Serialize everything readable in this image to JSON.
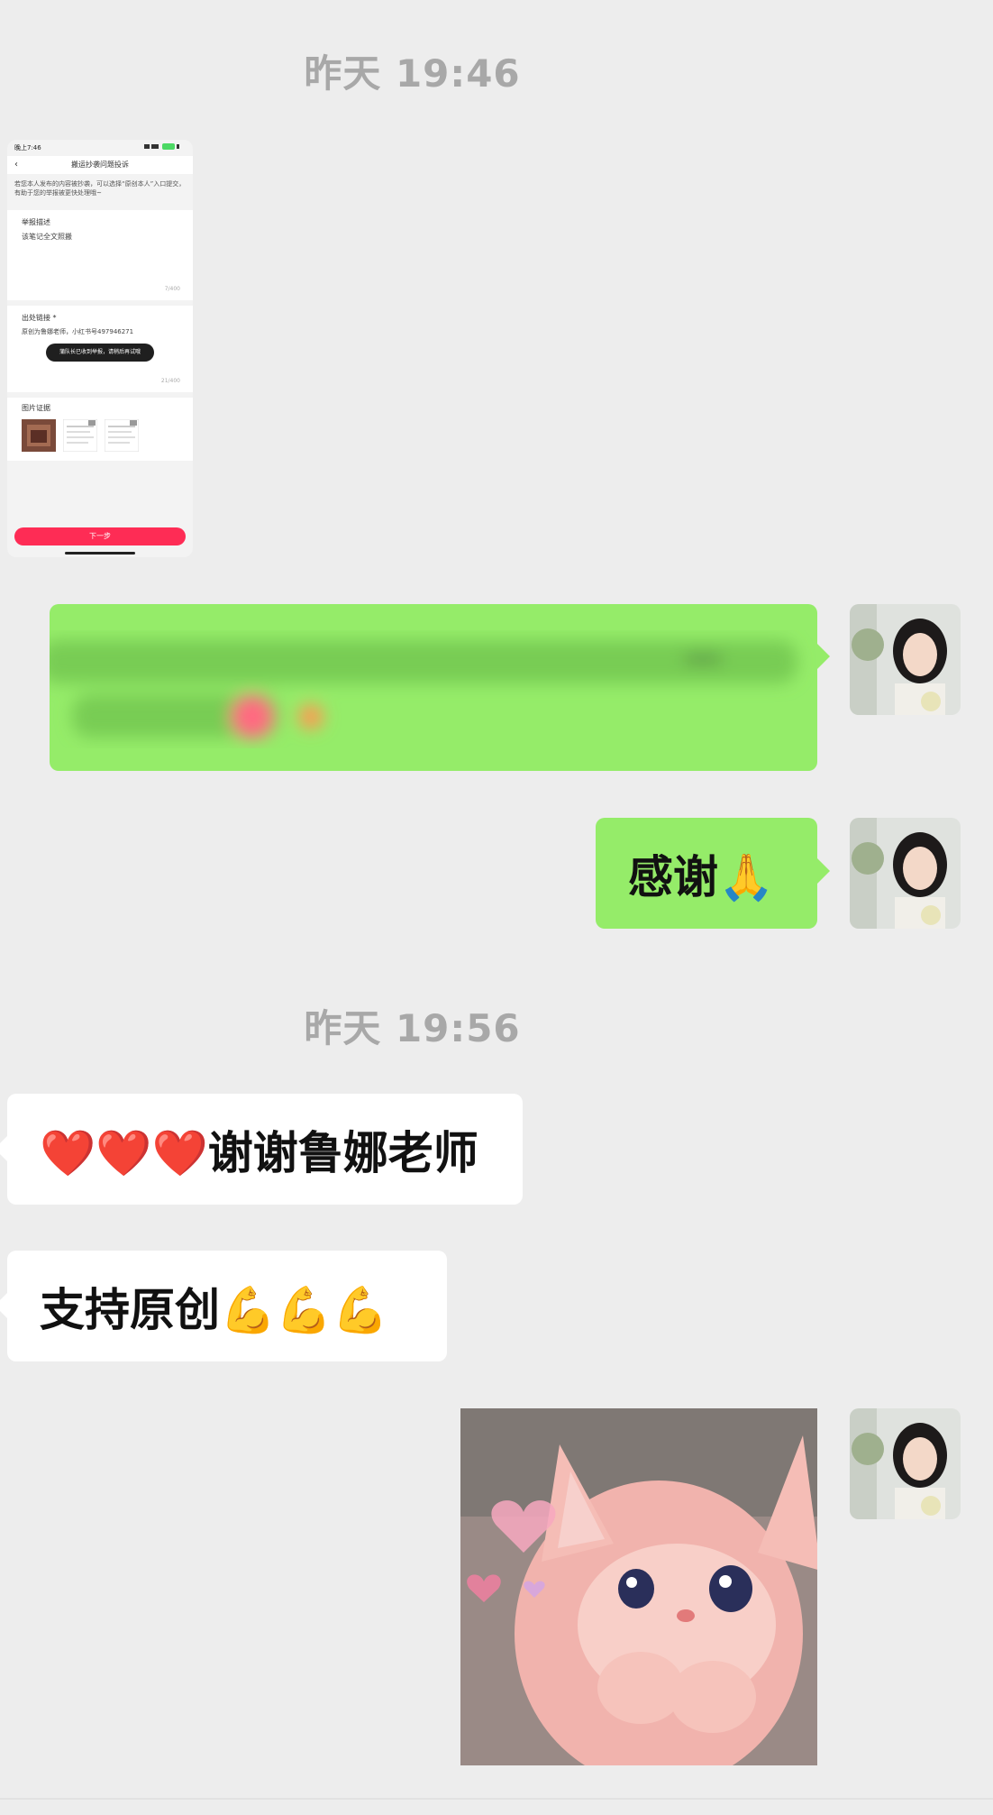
{
  "timestamps": {
    "first": "昨天 19:46",
    "second": "昨天 19:56"
  },
  "screenshot": {
    "status_time": "晚上7:46",
    "title": "搬运抄袭问题投诉",
    "notice": "若您本人发布的内容被抄袭，可以选择“原创本人”入口提交，有助于您的举报被更快处理哦~",
    "desc_title": "举报描述",
    "desc_value": "该笔记全文照搬",
    "desc_count": "7/400",
    "link_title": "出处链接 *",
    "link_value": "原创为鲁娜老师，小红书号497946271",
    "link_count": "21/400",
    "toast": "蒲队长已收到举报，请稍后再试哦",
    "images_title": "图片证据",
    "next_button": "下一步"
  },
  "messages": {
    "blurred_text": "",
    "thanks": "感谢🙏",
    "reply1": "❤️❤️❤️谢谢鲁娜老师",
    "reply2": "支持原创💪💪💪"
  },
  "colors": {
    "background": "#ededed",
    "sent_bubble": "#95ec69",
    "received_bubble": "#ffffff",
    "timestamp": "#a8a8a8",
    "accent_red": "#fe2c55"
  }
}
